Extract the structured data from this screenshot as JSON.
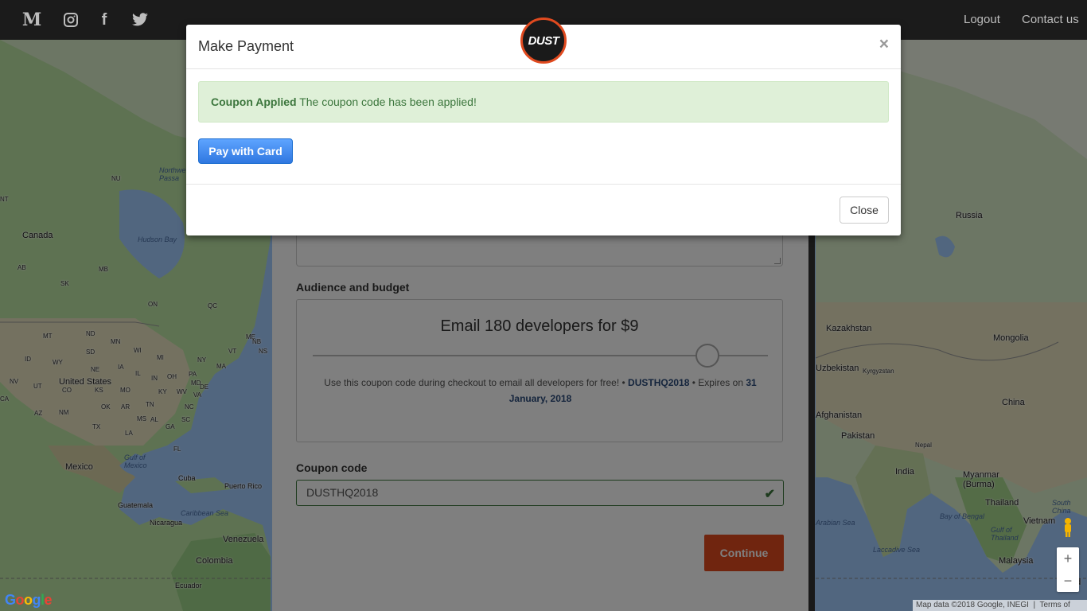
{
  "nav": {
    "icons": [
      "medium-icon",
      "instagram-icon",
      "facebook-icon",
      "twitter-icon"
    ],
    "logout": "Logout",
    "contact": "Contact us"
  },
  "map": {
    "labels": {
      "canada": "Canada",
      "hudson_bay": "Hudson Bay",
      "northwest_passages": "Northwe\nPassa",
      "united_states": "United States",
      "mexico": "Mexico",
      "gulf_mexico": "Gulf of\nMexico",
      "cuba": "Cuba",
      "puerto_rico": "Puerto Rico",
      "guatemala": "Guatemala",
      "nicaragua": "Nicaragua",
      "caribbean": "Caribbean Sea",
      "venezuela": "Venezuela",
      "colombia": "Colombia",
      "ecuador": "Ecuador",
      "russia": "Russia",
      "kazakhstan": "Kazakhstan",
      "mongolia": "Mongolia",
      "uzbekistan": "Uzbekistan",
      "kyrgyzstan": "Kyrgyzstan",
      "afghanistan": "Afghanistan",
      "pakistan": "Pakistan",
      "china": "China",
      "nepal": "Nepal",
      "india": "India",
      "myanmar": "Myanmar\n(Burma)",
      "thailand": "Thailand",
      "vietnam": "Vietnam",
      "malaysia": "Malaysia",
      "bay_bengal": "Bay of Bengal",
      "arabian_sea": "Arabian Sea",
      "laccadive": "Laccadive Sea",
      "south_china": "South\nChina",
      "gulf_thailand": "Gulf of\nThailand",
      "ind": "Ind"
    },
    "states": [
      "NU",
      "AB",
      "SK",
      "MB",
      "ON",
      "QC",
      "MT",
      "ND",
      "MN",
      "WI",
      "MI",
      "ME",
      "NB",
      "NS",
      "ID",
      "SD",
      "WY",
      "NE",
      "IA",
      "IL",
      "IN",
      "OH",
      "PA",
      "NY",
      "VT",
      "MA",
      "NV",
      "UT",
      "CO",
      "KS",
      "MO",
      "KY",
      "WV",
      "MD",
      "DE",
      "CA",
      "AZ",
      "NM",
      "OK",
      "AR",
      "TN",
      "NC",
      "VA",
      "SC",
      "TX",
      "LA",
      "MS",
      "AL",
      "GA",
      "FL",
      "NT",
      "OR",
      "WA"
    ],
    "attribution": "Map data ©2018 Google, INEGI",
    "terms": "Terms of Use",
    "google": "Google"
  },
  "form": {
    "audience_label": "Audience and budget",
    "audience_title": "Email 180 developers for $9",
    "slider_fraction": 0.87,
    "coupon_note_prefix": "Use this coupon code during checkout to email all developers for free! • ",
    "coupon_code_inline": "DUSTHQ2018",
    "coupon_note_mid": " • Expires on ",
    "expires": "31 January, 2018",
    "coupon_label": "Coupon code",
    "coupon_value": "DUSTHQ2018",
    "continue": "Continue"
  },
  "modal": {
    "title": "Make Payment",
    "close_x": "×",
    "logo": "DUST",
    "alert_strong": "Coupon Applied",
    "alert_text": " The coupon code has been applied!",
    "pay_button": "Pay with Card",
    "close_button": "Close"
  }
}
